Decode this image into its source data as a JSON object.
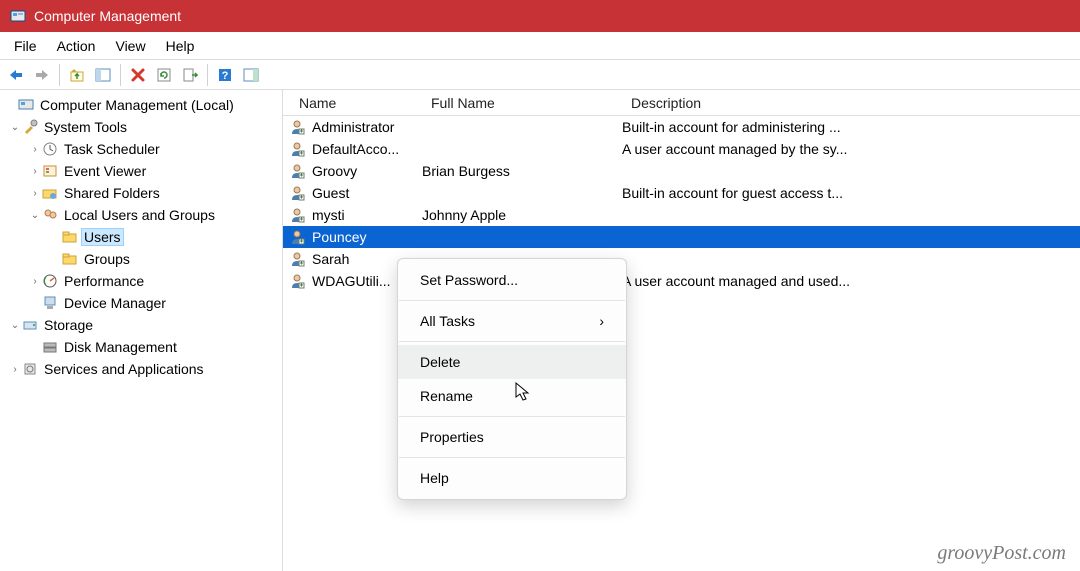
{
  "title": "Computer Management",
  "menubar": {
    "file": "File",
    "action": "Action",
    "view": "View",
    "help": "Help"
  },
  "tree": {
    "root": "Computer Management (Local)",
    "systools": "System Tools",
    "task": "Task Scheduler",
    "event": "Event Viewer",
    "shared": "Shared Folders",
    "lug": "Local Users and Groups",
    "users": "Users",
    "groups": "Groups",
    "perf": "Performance",
    "devmgr": "Device Manager",
    "storage": "Storage",
    "disk": "Disk Management",
    "services": "Services and Applications"
  },
  "columns": {
    "name": "Name",
    "full": "Full Name",
    "desc": "Description"
  },
  "users": [
    {
      "name": "Administrator",
      "full": "",
      "desc": "Built-in account for administering ..."
    },
    {
      "name": "DefaultAcco...",
      "full": "",
      "desc": "A user account managed by the sy..."
    },
    {
      "name": "Groovy",
      "full": "Brian Burgess",
      "desc": ""
    },
    {
      "name": "Guest",
      "full": "",
      "desc": "Built-in account for guest access t..."
    },
    {
      "name": "mysti",
      "full": "Johnny Apple",
      "desc": ""
    },
    {
      "name": "Pouncey",
      "full": "",
      "desc": ""
    },
    {
      "name": "Sarah",
      "full": "",
      "desc": ""
    },
    {
      "name": "WDAGUtili...",
      "full": "",
      "desc": "A user account managed and used..."
    }
  ],
  "ctx": {
    "setpw": "Set Password...",
    "alltasks": "All Tasks",
    "delete": "Delete",
    "rename": "Rename",
    "properties": "Properties",
    "help": "Help"
  },
  "watermark": "groovyPost.com"
}
